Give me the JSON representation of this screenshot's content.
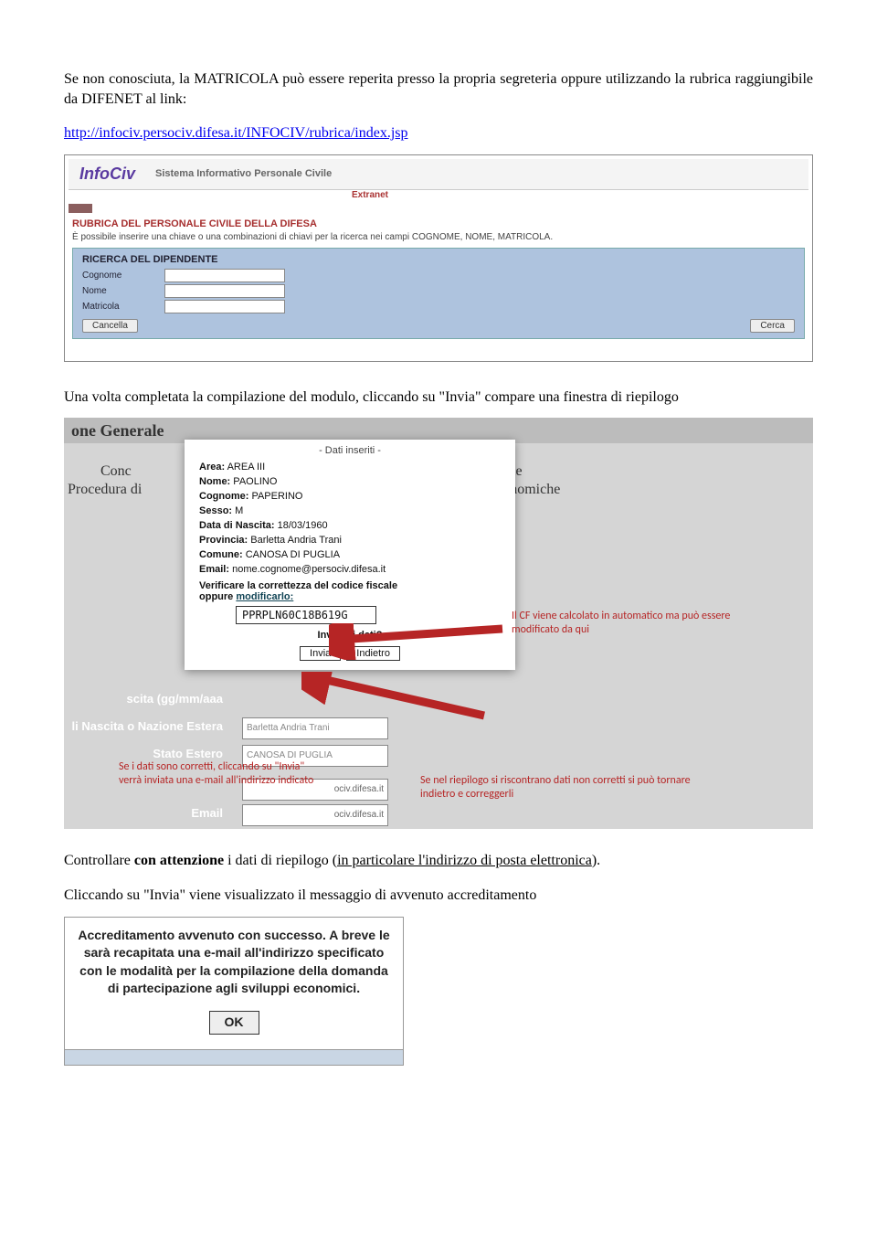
{
  "intro": {
    "p1": "Se non conosciuta, la MATRICOLA può essere reperita presso la propria segreteria oppure utilizzando la rubrica raggiungibile da DIFENET al link:",
    "link": "http://infociv.persociv.difesa.it/INFOCIV/rubrica/index.jsp"
  },
  "infociv": {
    "logo": "InfoCiv",
    "subtitle": "Sistema Informativo Personale Civile",
    "extranet": "Extranet",
    "section_title": "RUBRICA DEL PERSONALE CIVILE DELLA DIFESA",
    "section_desc": "È possibile inserire una chiave o una combinazioni di chiavi per la ricerca nei campi COGNOME, NOME, MATRICOLA.",
    "panel_title": "RICERCA DEL DIPENDENTE",
    "labels": {
      "cognome": "Cognome",
      "nome": "Nome",
      "matricola": "Matricola"
    },
    "btn_cancel": "Cancella",
    "btn_search": "Cerca"
  },
  "mid_para": "Una volta completata la compilazione del modulo, cliccando su \"Invia\" compare una finestra di riepilogo",
  "riepilogo": {
    "bg_header": "one Generale",
    "bg_sub1": "Conc",
    "bg_sub2": "Procedura di",
    "bg_sub1b": "civile",
    "bg_sub2b": "economiche",
    "bg_labels": {
      "scita": "scita (gg/mm/aaa",
      "nascita": "li Nascita o Nazione Estera",
      "stato": "Stato Estero",
      "email": "Email"
    },
    "bg_inputs": {
      "nascita": "Barletta Andria Trani",
      "stato": "CANOSA DI PUGLIA",
      "email1": "ociv.difesa.it",
      "email2": "ociv.difesa.it"
    },
    "modal": {
      "header": "- Dati inseriti -",
      "area_l": "Area:",
      "area_v": "AREA III",
      "nome_l": "Nome:",
      "nome_v": "PAOLINO",
      "cogn_l": "Cognome:",
      "cogn_v": "PAPERINO",
      "sesso_l": "Sesso:",
      "sesso_v": "M",
      "dn_l": "Data di Nascita:",
      "dn_v": "18/03/1960",
      "prov_l": "Provincia:",
      "prov_v": "Barletta Andria Trani",
      "com_l": "Comune:",
      "com_v": "CANOSA DI PUGLIA",
      "email_l": "Email:",
      "email_v": "nome.cognome@persociv.difesa.it",
      "cf_instr1": "Verificare la correttezza del codice fiscale",
      "cf_instr2": "oppure ",
      "cf_modify": "modificarlo:",
      "cf_value": "PPRPLN60C18B619G",
      "send_q": "Inviare i dati?",
      "btn_invia": "Invia",
      "btn_indietro": "Indietro"
    },
    "annot_cf": "Il CF viene calcolato in automatico ma può essere modificato da qui",
    "annot_invia": "Se i dati sono corretti, cliccando su \"Invia\" verrà inviata una e-mail all'indirizzo indicato",
    "annot_indietro": "Se nel riepilogo si riscontrano dati non corretti si può tornare indietro e correggerli"
  },
  "after1": "Controllare con attenzione i dati di riepilogo (in particolare l'indirizzo di posta elettronica).",
  "after2": "Cliccando su \"Invia\" viene visualizzato il messaggio di avvenuto accreditamento",
  "success": {
    "msg": "Accreditamento avvenuto con successo. A breve le sarà recapitata una e-mail all'indirizzo specificato con le modalità per la compilazione della domanda di partecipazione agli sviluppi economici.",
    "ok": "OK"
  }
}
